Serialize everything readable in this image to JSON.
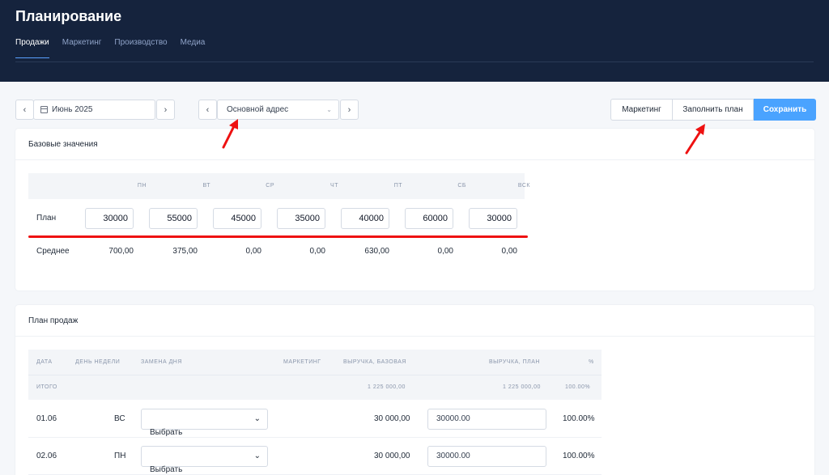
{
  "header": {
    "title": "Планирование",
    "tabs": [
      "Продажи",
      "Маркетинг",
      "Производство",
      "Медиа"
    ],
    "active_tab": "Продажи"
  },
  "toolbar": {
    "month": "Июнь 2025",
    "address": "Основной адрес",
    "prev_icon": "‹",
    "next_icon": "›",
    "marketing_label": "Маркетинг",
    "fill_label": "Заполнить план",
    "save_label": "Сохранить"
  },
  "base_values": {
    "title": "Базовые значения",
    "days": [
      "ПН",
      "ВТ",
      "СР",
      "ЧТ",
      "ПТ",
      "СБ",
      "ВСК"
    ],
    "plan_label": "План",
    "plan": [
      "30000",
      "55000",
      "45000",
      "35000",
      "40000",
      "60000",
      "30000"
    ],
    "avg_label": "Среднее",
    "avg": [
      "700,00",
      "375,00",
      "0,00",
      "0,00",
      "630,00",
      "0,00",
      "0,00"
    ]
  },
  "sales_plan": {
    "title": "План продаж",
    "columns": [
      "Дата",
      "День недели",
      "Замена дня",
      "Маркетинг",
      "Выручка, базовая",
      "Выручка, план",
      "%"
    ],
    "total_label": "Итого",
    "total_base": "1 225 000,00",
    "total_plan": "1 225 000,00",
    "total_pct": "100.00%",
    "select_placeholder": "Выбрать",
    "rows": [
      {
        "date": "01.06",
        "weekday": "ВС",
        "base": "30 000,00",
        "plan": "30000.00",
        "pct": "100.00%"
      },
      {
        "date": "02.06",
        "weekday": "ПН",
        "base": "30 000,00",
        "plan": "30000.00",
        "pct": "100.00%"
      }
    ]
  },
  "colors": {
    "header_bg": "#15233d",
    "accent": "#4aa3ff",
    "annotation": "#ee1111"
  }
}
